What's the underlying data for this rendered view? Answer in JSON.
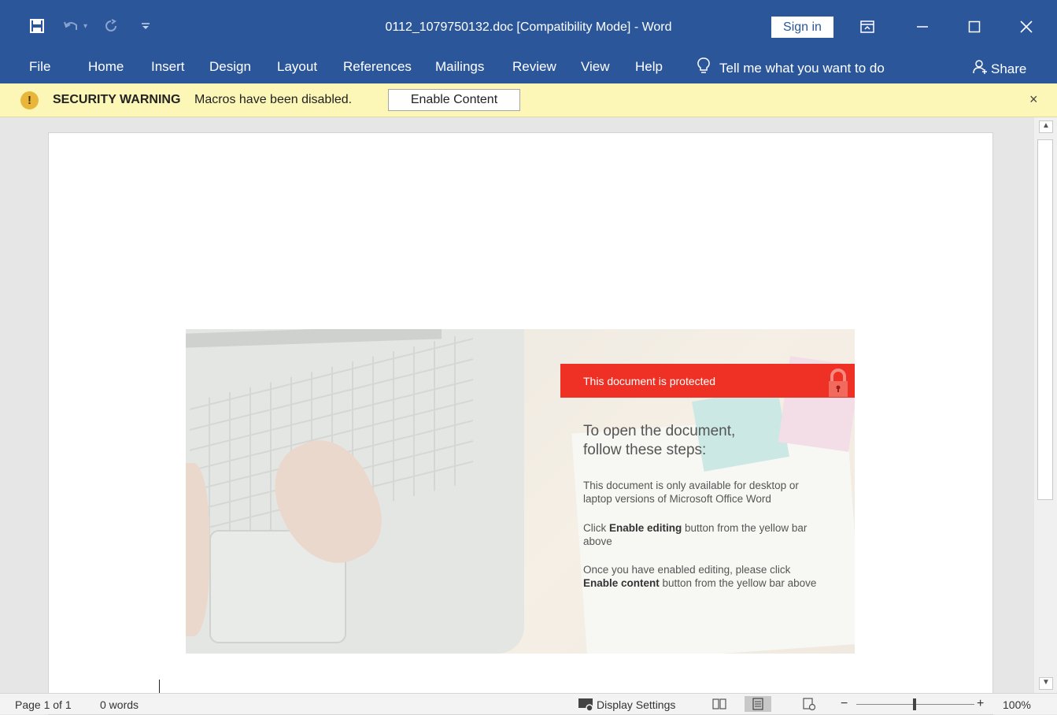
{
  "window": {
    "title": "0112_1079750132.doc [Compatibility Mode]  -  Word",
    "sign_in": "Sign in"
  },
  "ribbon": {
    "tabs": [
      "File",
      "Home",
      "Insert",
      "Design",
      "Layout",
      "References",
      "Mailings",
      "Review",
      "View",
      "Help"
    ],
    "tell_me": "Tell me what you want to do",
    "share": "Share"
  },
  "security_bar": {
    "label": "SECURITY WARNING",
    "message": "Macros have been disabled.",
    "button": "Enable Content",
    "close": "×"
  },
  "document": {
    "banner": "This document is protected",
    "heading_line1": "To open the document,",
    "heading_line2": "follow these steps:",
    "p1": "This document is only available for desktop or laptop versions of Microsoft Office Word",
    "p2_bold": "Enable editing",
    "p2_pre": "Click ",
    "p2_post": " button from the yellow bar above",
    "p3_pre": "Once you have enabled editing, please click ",
    "p3_bold": "Enable content",
    "p3_post": " button from the yellow bar above"
  },
  "status_bar": {
    "page": "Page 1 of 1",
    "words": "0 words",
    "display_settings": "Display Settings",
    "zoom_minus": "−",
    "zoom_plus": "+",
    "zoom": "100%",
    "zoom_level": 1.0
  },
  "colors": {
    "word_blue": "#2b579a",
    "warning_bar": "#fcf7b6",
    "banner_red": "#ee3124"
  },
  "icons": [
    "save-icon",
    "undo-icon",
    "redo-icon",
    "customize-icon",
    "ribbon-display-icon",
    "minimize-icon",
    "maximize-icon",
    "close-icon",
    "lightbulb-icon",
    "share-icon",
    "warning-icon",
    "lock-icon",
    "display-settings-icon",
    "read-mode-icon",
    "print-layout-icon",
    "web-layout-icon"
  ]
}
